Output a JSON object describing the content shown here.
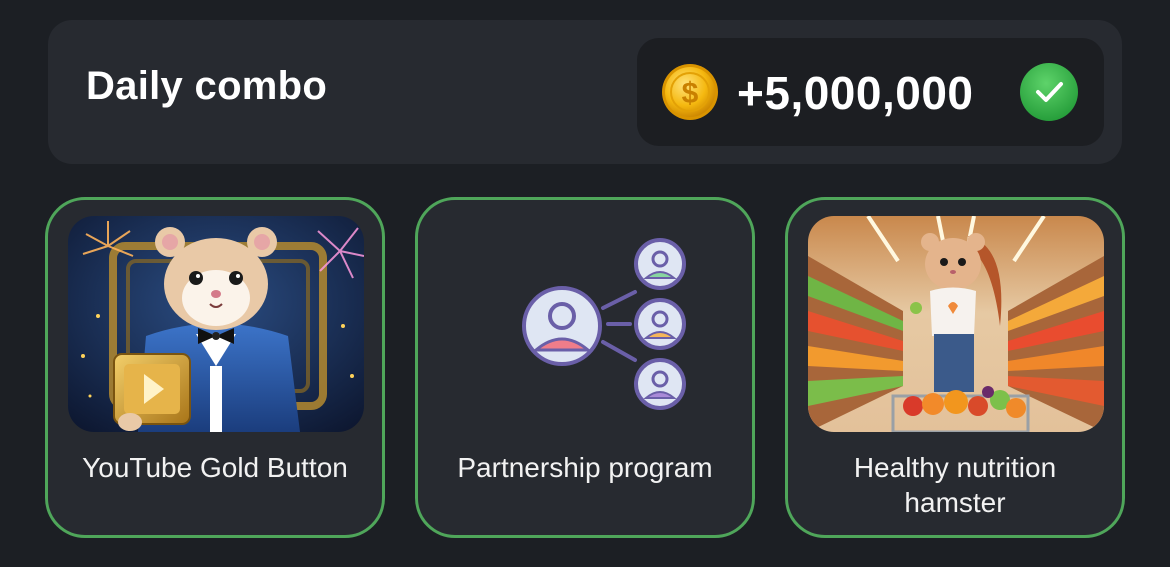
{
  "header": {
    "title": "Daily combo",
    "reward_amount": "+5,000,000",
    "coin_icon": "coin-icon",
    "status_icon": "check-circle-icon",
    "status_color": "#3cb54a"
  },
  "cards": [
    {
      "label": "YouTube Gold Button",
      "image": "hamster-youtube-gold-button-illustration",
      "completed": true
    },
    {
      "label": "Partnership program",
      "image": "partnership-network-icon",
      "completed": false
    },
    {
      "label": "Healthy nutrition hamster",
      "label_line1": "Healthy nutrition",
      "label_line2": "hamster",
      "image": "hamster-supermarket-illustration",
      "completed": true
    }
  ],
  "colors": {
    "background": "#1c1f24",
    "panel": "#272a30",
    "completed_border": "#4fa65a",
    "accent_gold": "#f5c518"
  }
}
